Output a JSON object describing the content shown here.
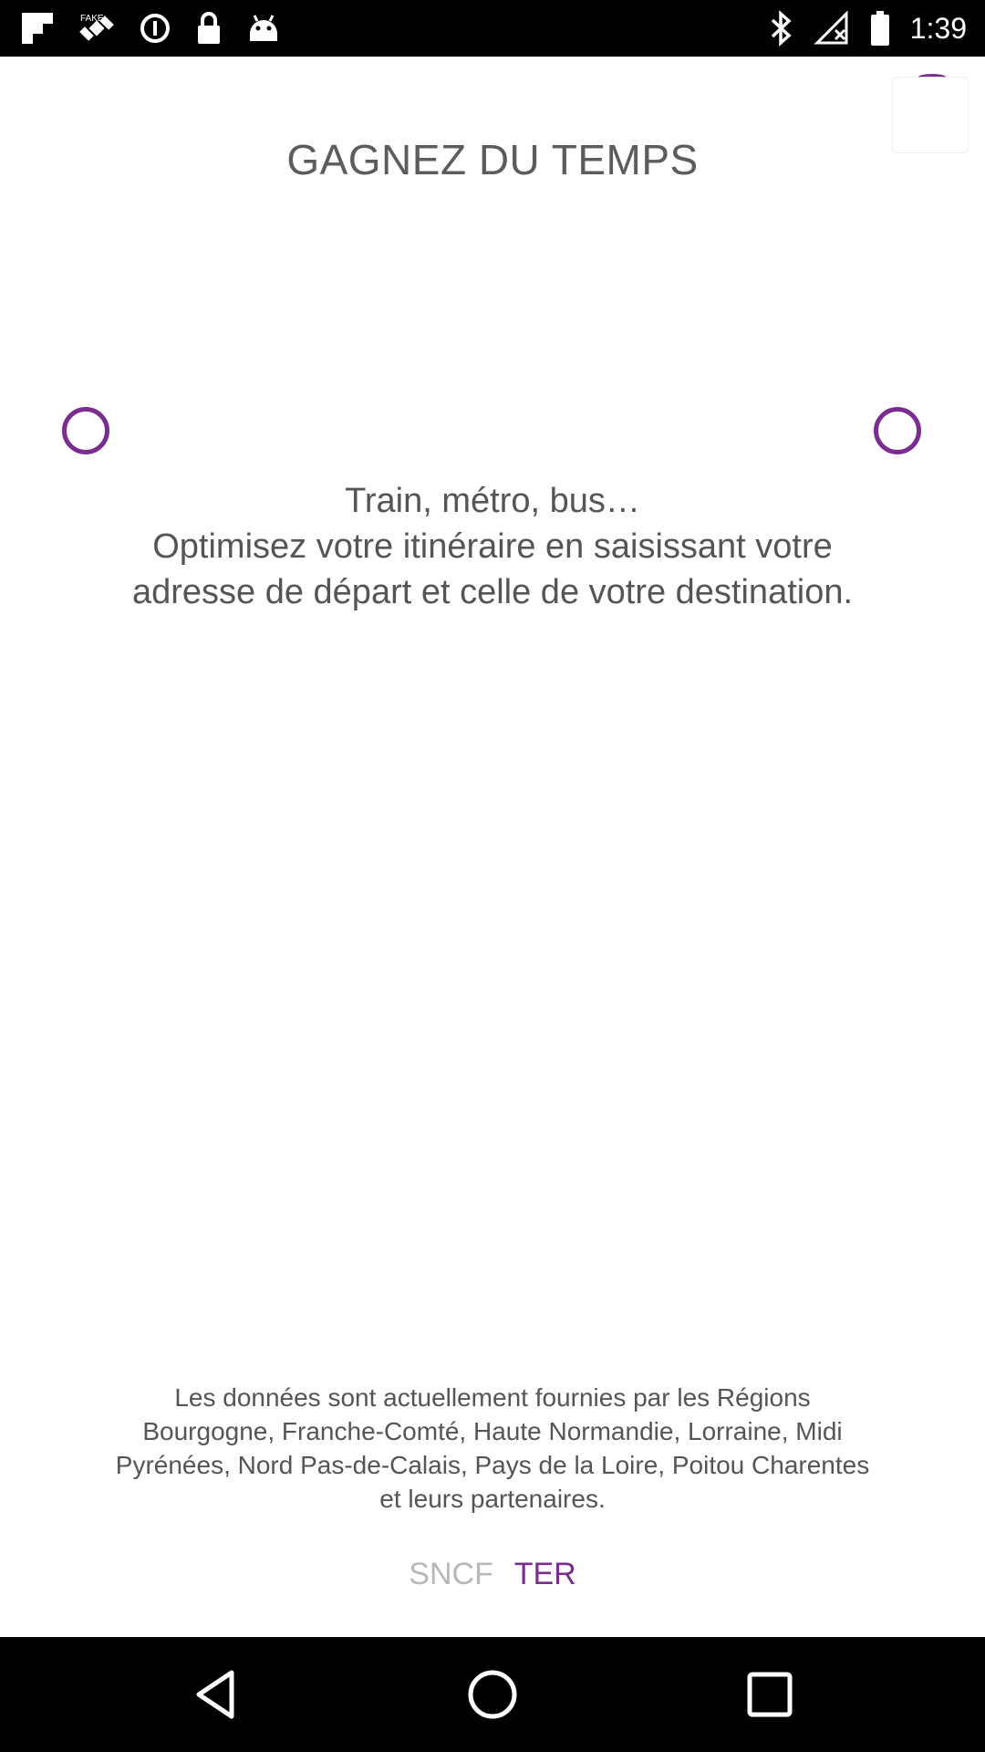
{
  "status_bar": {
    "time": "1:39",
    "left_icons": [
      "flipboard-icon",
      "fake-gps-icon",
      "data-saver-icon",
      "lock-icon",
      "android-icon"
    ],
    "right_icons": [
      "bluetooth-icon",
      "signal-off-icon",
      "battery-icon"
    ]
  },
  "onboarding": {
    "title": "GAGNEZ DU TEMPS",
    "body_lines": [
      "Train, métro, bus…",
      "Optimisez votre itinéraire en saisissant votre",
      "adresse de départ et celle de votre destination."
    ],
    "footer_lines": [
      "Les données sont actuellement fournies par les Régions",
      "Bourgogne, Franche-Comté, Haute Normandie, Lorraine, Midi",
      "Pyrénées, Nord Pas-de-Calais, Pays de la Loire, Poitou Charentes",
      "et leurs partenaires."
    ],
    "logo_sncf": "SNCF",
    "logo_ter": "TER"
  },
  "colors": {
    "accent": "#7a2d8e",
    "text": "#555555",
    "logo_gray": "#b8b8b8"
  }
}
